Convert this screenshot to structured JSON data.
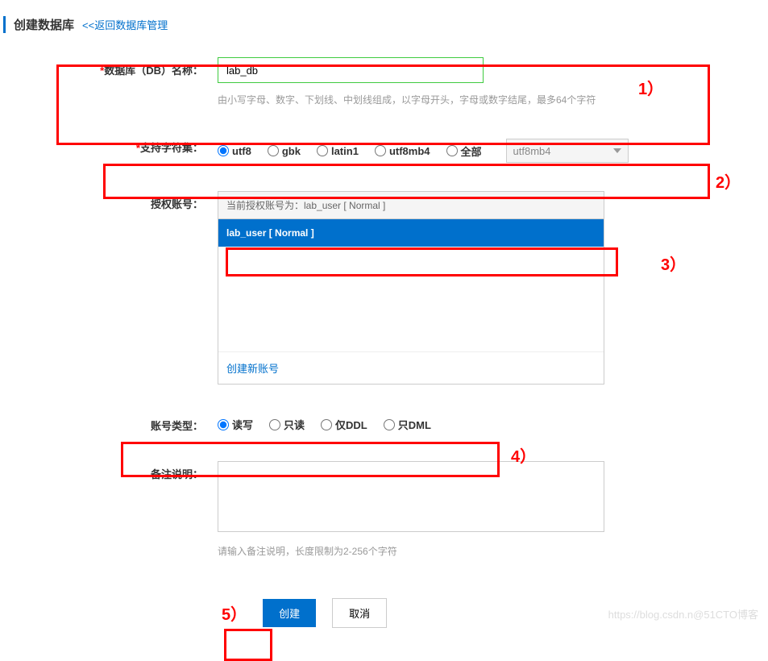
{
  "header": {
    "title": "创建数据库",
    "back_link": "<<返回数据库管理"
  },
  "form": {
    "db_name": {
      "label": "数据库（DB）名称：",
      "value": "lab_db",
      "hint": "由小写字母、数字、下划线、中划线组成，以字母开头，字母或数字结尾，最多64个字符"
    },
    "charset": {
      "label": "支持字符集：",
      "options": [
        "utf8",
        "gbk",
        "latin1",
        "utf8mb4",
        "全部"
      ],
      "selected": "utf8",
      "dropdown_value": "utf8mb4"
    },
    "account": {
      "label": "授权账号：",
      "current_text": "当前授权账号为：lab_user [ Normal ]",
      "selected_item": "lab_user [ Normal ]",
      "create_link": "创建新账号"
    },
    "account_type": {
      "label": "账号类型：",
      "options": [
        "读写",
        "只读",
        "仅DDL",
        "只DML"
      ],
      "selected": "读写"
    },
    "remark": {
      "label": "备注说明：",
      "value": "",
      "hint": "请输入备注说明，长度限制为2-256个字符"
    },
    "buttons": {
      "create": "创建",
      "cancel": "取消"
    }
  },
  "annotations": {
    "a1": "1）",
    "a2": "2）",
    "a3": "3）",
    "a4": "4）",
    "a5": "5）"
  },
  "watermark": "https://blog.csdn.n@51CTO博客"
}
